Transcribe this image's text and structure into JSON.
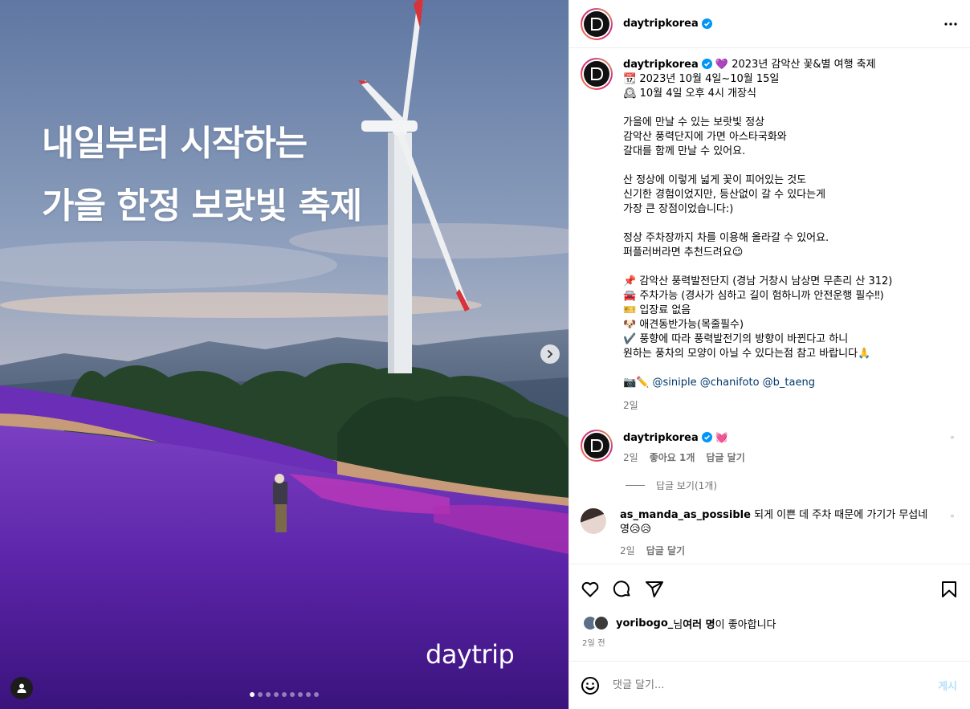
{
  "post": {
    "username": "daytripkorea",
    "avatar_text": "D",
    "image_text": {
      "line1": "내일부터 시작하는",
      "line2": "가을 한정 보랏빛 축제",
      "watermark": "daytrip"
    },
    "carousel": {
      "total": 9,
      "active": 1
    },
    "caption_lines": [
      "💜 2023년 감악산 꽃&별 여행 축제",
      "📆 2023년 10월 4일~10월 15일",
      "🕰 10월 4일 오후 4시 개장식",
      "",
      "가을에 만날 수 있는 보랏빛 정상",
      "감악산 풍력단지에 가면 아스타국화와",
      "갈대를 함께 만날 수 있어요.",
      "",
      "산 정상에 이렇게 넓게 꽃이 피어있는 것도",
      "신기한 경험이었지만, 등산없이 갈 수 있다는게",
      "가장 큰 장점이었습니다:)",
      "",
      "정상 주차장까지 차를 이용해 올라갈 수 있어요.",
      "퍼플러버라면 추천드려요😉",
      "",
      "📌 감악산 풍력발전단지 (경남 거창시 남상면 무촌리 산 312)",
      "🚘 주차가능 (경사가 심하고 길이 험하니까 안전운행 필수‼)",
      "🎫 입장료 없음",
      "🐶 애견동반가능(목줄필수)",
      "✔️ 풍향에 따라 풍력발전기의 방향이 바뀐다고 하니",
      "원하는 풍차의 모양이 아닐 수 있다는점 참고 바랍니다🙏",
      ""
    ],
    "credit_icons": "📷✏️",
    "credits": "@siniple @chanifoto @b_taeng",
    "caption_time": "2일"
  },
  "comments": [
    {
      "username": "daytripkorea",
      "text": "💓",
      "time": "2일",
      "likes": "좋아요 1개",
      "reply": "답글 달기",
      "view_replies": "답글 보기(1개)"
    },
    {
      "username": "as_manda_as_possible",
      "text": "되게 이쁜 데 주차 때문에 가기가 무섭네",
      "text2": "영😥😥",
      "time": "2일",
      "reply": "답글 달기"
    }
  ],
  "likes_line": {
    "user": "yoribogo_",
    "mid": "님 ",
    "others": "여러 명",
    "tail": "이 좋아합니다"
  },
  "time_ago": "2일 전",
  "add_comment": {
    "placeholder": "댓글 달기...",
    "post_label": "게시"
  },
  "colors": {
    "verified": "#0095f6",
    "link": "#00376b",
    "post_button": "#b2dffc"
  },
  "icons": [
    "heart-icon",
    "comment-icon",
    "share-icon",
    "bookmark-icon",
    "emoji-icon",
    "more-icon",
    "verified-icon",
    "chevron-right-icon",
    "user-tag-icon"
  ]
}
